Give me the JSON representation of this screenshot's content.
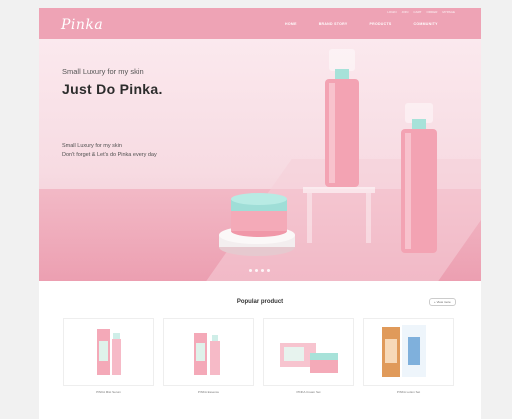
{
  "header": {
    "logo": "Pinka",
    "util_links": [
      "LOGIN",
      "JOIN",
      "CART",
      "ORDER",
      "MYPAGE"
    ],
    "nav": [
      "HOME",
      "BRAND STORY",
      "PRODUCTS",
      "COMMUNITY"
    ]
  },
  "hero": {
    "subtitle": "Small Luxury for my skin",
    "title": "Just Do Pinka.",
    "desc_line1": "Small Luxury for my skin",
    "desc_line2": "Don't forget & Let's do Pinka every day",
    "slide_count": 4
  },
  "products": {
    "section_title": "Popular product",
    "view_more": "+ View more",
    "items": [
      {
        "name": "PINKA Mist Serum"
      },
      {
        "name": "PINKA Essence"
      },
      {
        "name": "PINKA Cream Set"
      },
      {
        "name": "PINKA Lotion Set"
      }
    ]
  },
  "colors": {
    "brand_pink": "#eea3b5",
    "hero_bg": "#f7dbe2"
  }
}
